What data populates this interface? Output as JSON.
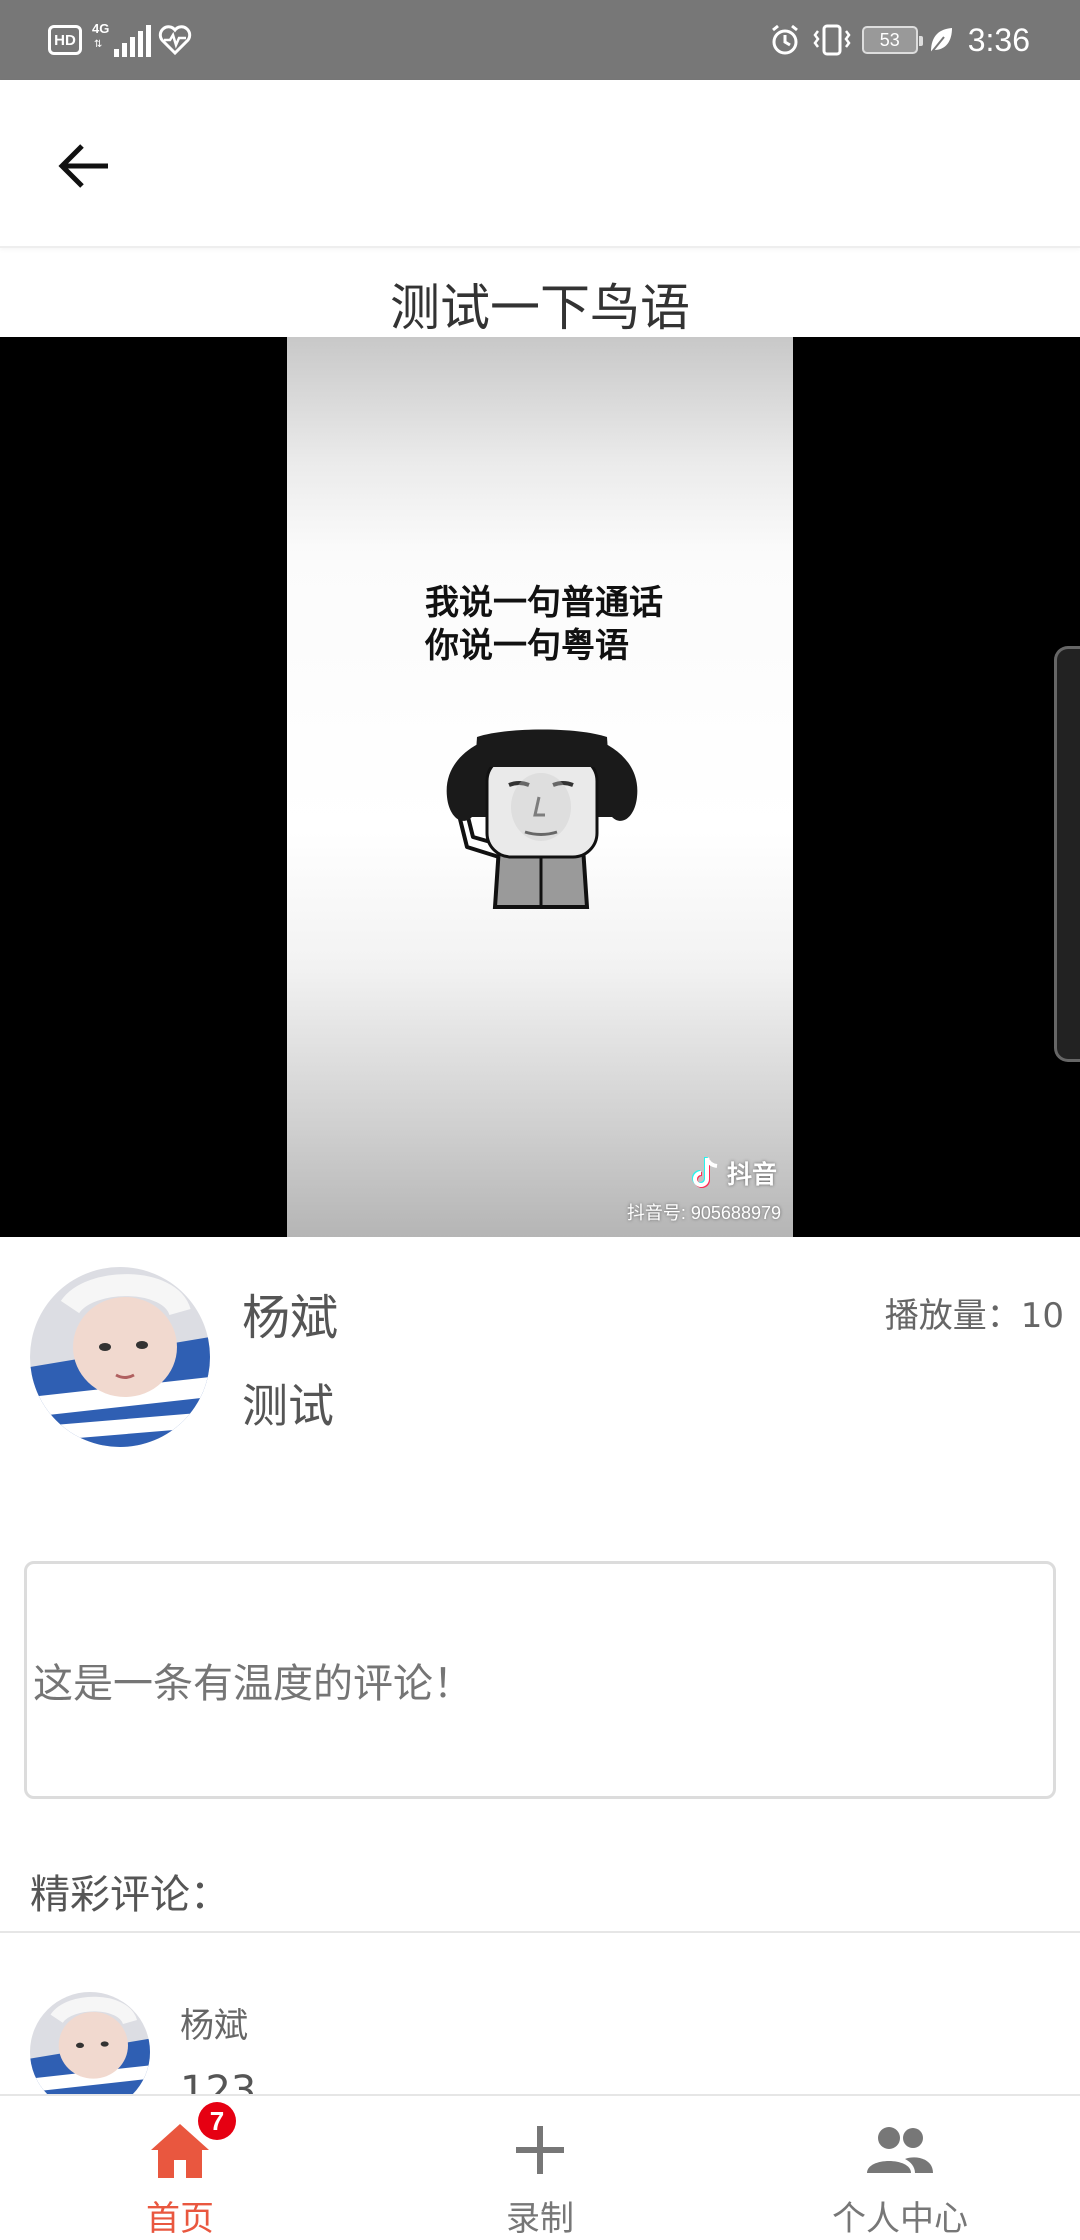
{
  "status_bar": {
    "hd": "HD",
    "network": "4G",
    "battery": "53",
    "time": "3:36"
  },
  "page": {
    "title": "测试一下鸟语"
  },
  "video": {
    "caption_line1": "我说一句普通话",
    "caption_line2": "你说一句粤语",
    "watermark_brand": "抖音",
    "watermark_id": "抖音号: 905688979"
  },
  "author": {
    "name": "杨斌",
    "description": "测试",
    "play_count": "播放量：10"
  },
  "comment_input": {
    "placeholder": "这是一条有温度的评论！"
  },
  "comments": {
    "header": "精彩评论：",
    "items": [
      {
        "author": "杨斌",
        "text": "123"
      }
    ]
  },
  "nav": {
    "items": [
      {
        "label": "首页",
        "badge": "7"
      },
      {
        "label": "录制"
      },
      {
        "label": "个人中心"
      }
    ]
  },
  "colors": {
    "status_bar": "#777777",
    "accent": "#e9573f",
    "badge": "#e60012",
    "inactive": "#777777"
  }
}
